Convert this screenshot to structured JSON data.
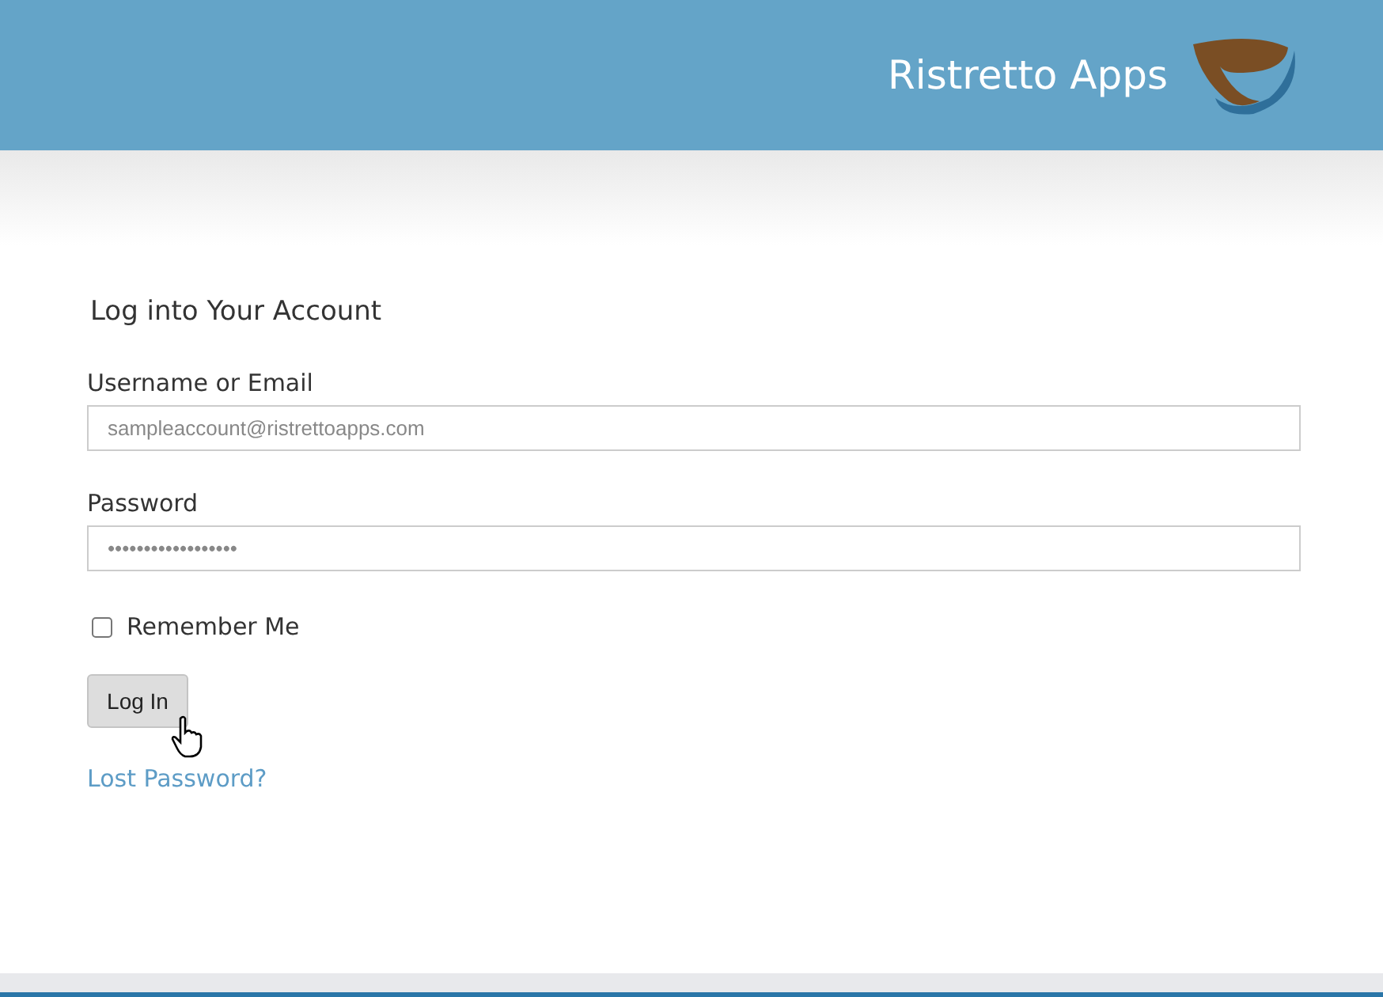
{
  "header": {
    "brand": "Ristretto Apps"
  },
  "form": {
    "title": "Log into Your Account",
    "username": {
      "label": "Username or Email",
      "value": "sampleaccount@ristrettoapps.com"
    },
    "password": {
      "label": "Password",
      "value": "••••••••••••••••••"
    },
    "remember": {
      "label": "Remember Me",
      "checked": false
    },
    "submit": "Log In",
    "lost_password": "Lost Password?"
  }
}
